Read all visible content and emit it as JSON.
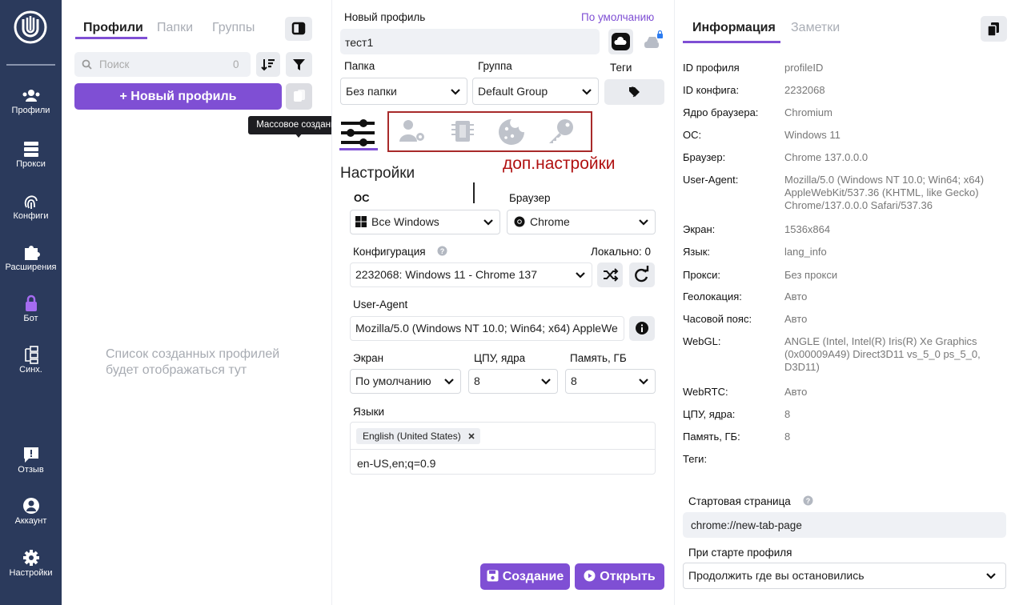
{
  "nav": {
    "items": [
      {
        "label": "Профили"
      },
      {
        "label": "Прокси"
      },
      {
        "label": "Конфиги"
      },
      {
        "label": "Расширения"
      },
      {
        "label": "Бот"
      },
      {
        "label": "Синх."
      },
      {
        "label": "Отзыв"
      },
      {
        "label": "Аккаунт"
      },
      {
        "label": "Настройки"
      }
    ]
  },
  "profiles_panel": {
    "tabs": [
      "Профили",
      "Папки",
      "Группы"
    ],
    "search": {
      "placeholder": "Поиск",
      "count": "0"
    },
    "new_profile_label": "+ Новый профиль",
    "tooltip": "Массовое создание",
    "empty_text": "Список созданных профилей будет отображаться тут"
  },
  "form": {
    "title_label": "Новый профиль",
    "default_link": "По умолчанию",
    "name_value": "тест1",
    "folder_label": "Папка",
    "folder_value": "Без папки",
    "group_label": "Группа",
    "group_value": "Default Group",
    "tags_label": "Теги",
    "annotation": "доп.настройки",
    "settings_title": "Настройки",
    "os_label": "ОС",
    "os_value": "Все Windows",
    "browser_label": "Браузер",
    "browser_value": "Chrome",
    "config_label": "Конфигурация",
    "config_local": "Локально: 0",
    "config_value": "2232068: Windows 11 - Chrome 137",
    "ua_label": "User-Agent",
    "ua_value": "Mozilla/5.0 (Windows NT 10.0; Win64; x64) AppleWe",
    "screen_label": "Экран",
    "screen_value": "По умолчанию",
    "cpu_label": "ЦПУ, ядра",
    "cpu_value": "8",
    "mem_label": "Память, ГБ",
    "mem_value": "8",
    "lang_label": "Языки",
    "lang_chip": "English (United States)",
    "lang_value": "en-US,en;q=0.9",
    "create_btn": "Создание",
    "open_btn": "Открыть"
  },
  "info": {
    "tabs": [
      "Информация",
      "Заметки"
    ],
    "rows": [
      {
        "k": "ID профиля",
        "v": "profileID"
      },
      {
        "k": "ID конфига:",
        "v": "2232068"
      },
      {
        "k": "Ядро браузера:",
        "v": "Chromium"
      },
      {
        "k": "ОС:",
        "v": "Windows 11"
      },
      {
        "k": "Браузер:",
        "v": "Chrome 137.0.0.0"
      },
      {
        "k": "User-Agent:",
        "v": "Mozilla/5.0 (Windows NT 10.0; Win64; x64) AppleWebKit/537.36 (KHTML, like Gecko) Chrome/137.0.0.0 Safari/537.36"
      },
      {
        "k": "Экран:",
        "v": "1536x864"
      },
      {
        "k": "Язык:",
        "v": "lang_info"
      },
      {
        "k": "Прокси:",
        "v": "Без прокси"
      },
      {
        "k": "Геолокация:",
        "v": "Авто"
      },
      {
        "k": "Часовой пояс:",
        "v": "Авто"
      },
      {
        "k": "WebGL:",
        "v": "ANGLE (Intel, Intel(R) Iris(R) Xe Graphics (0x00009A49) Direct3D11 vs_5_0 ps_5_0, D3D11)"
      },
      {
        "k": "WebRTC:",
        "v": "Авто"
      },
      {
        "k": "ЦПУ, ядра:",
        "v": "8"
      },
      {
        "k": "Память, ГБ:",
        "v": "8"
      },
      {
        "k": "Теги:",
        "v": ""
      }
    ],
    "start_page_label": "Стартовая страница",
    "start_page_value": "chrome://new-tab-page",
    "on_start_label": "При старте профиля",
    "on_start_value": "Продолжить где вы остановились"
  },
  "colors": {
    "accent": "#7f4fd4",
    "nav_bg": "#2b3a5c",
    "annotation": "#b01010"
  }
}
